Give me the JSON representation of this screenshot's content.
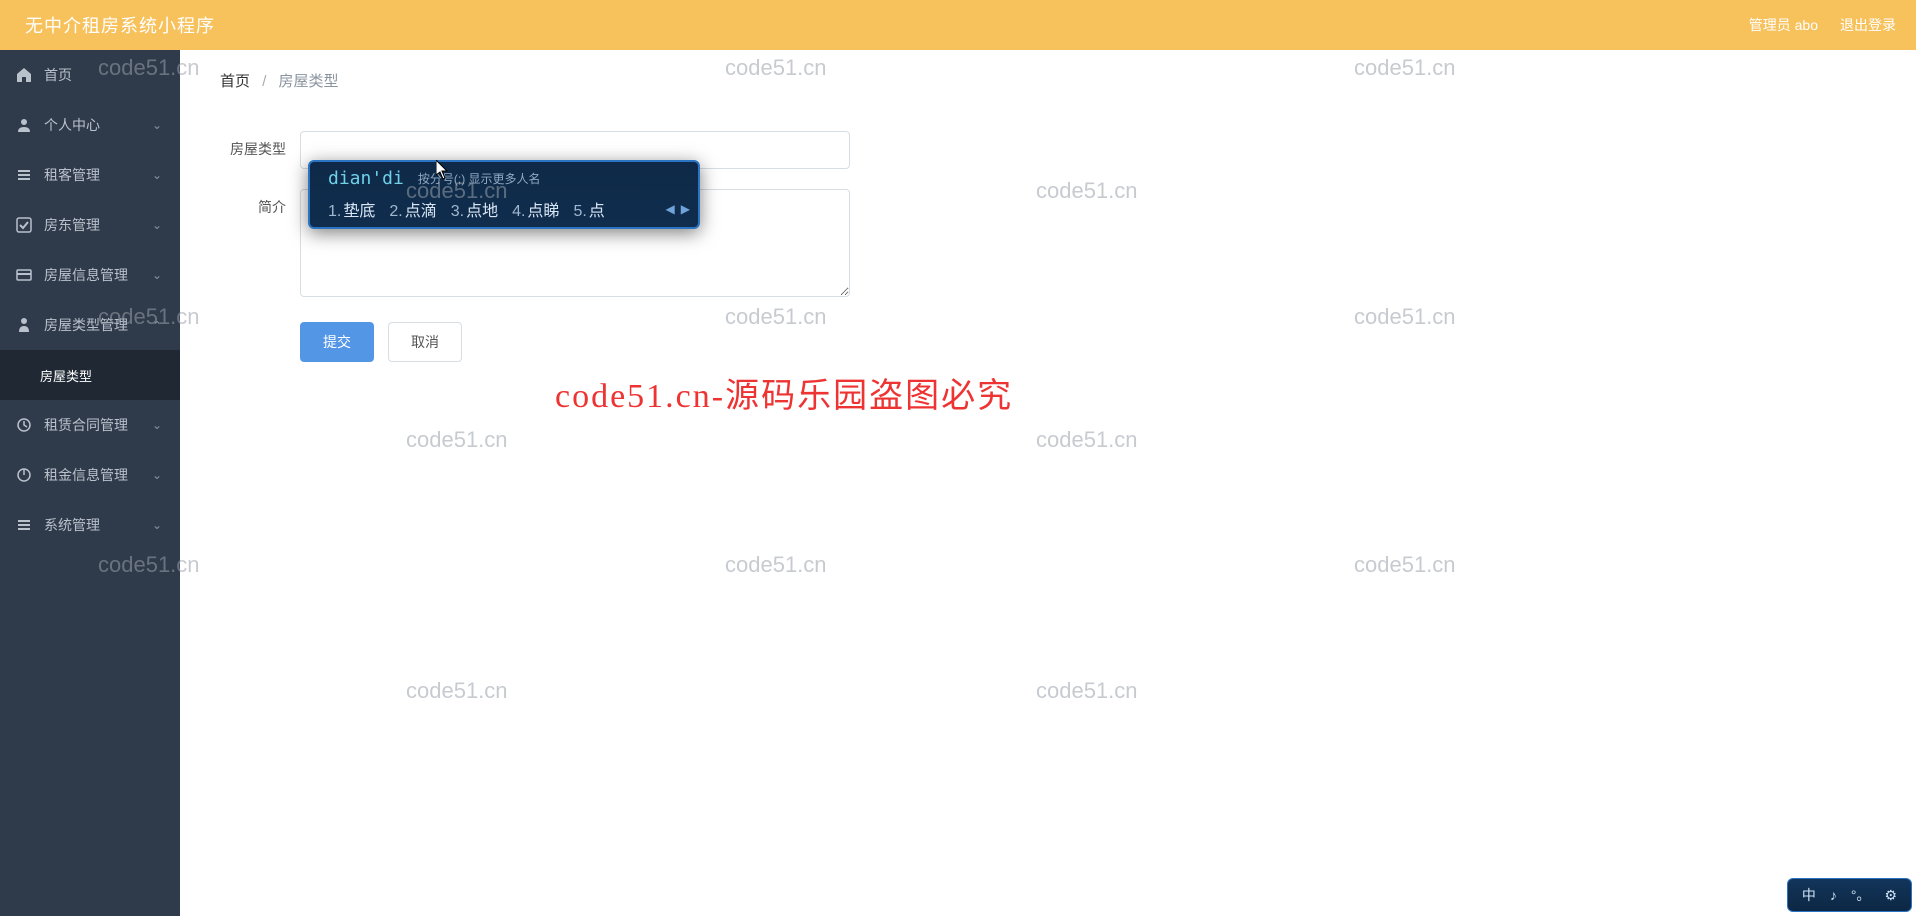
{
  "header": {
    "title": "无中介租房系统小程序",
    "user_label": "管理员 abo",
    "logout": "退出登录"
  },
  "sidebar": {
    "items": [
      {
        "icon": "home",
        "label": "首页",
        "expandable": false
      },
      {
        "icon": "user",
        "label": "个人中心",
        "expandable": true
      },
      {
        "icon": "list",
        "label": "租客管理",
        "expandable": true
      },
      {
        "icon": "check",
        "label": "房东管理",
        "expandable": true
      },
      {
        "icon": "card",
        "label": "房屋信息管理",
        "expandable": true
      },
      {
        "icon": "tag",
        "label": "房屋类型管理",
        "expandable": true,
        "expanded": true,
        "children": [
          {
            "label": "房屋类型",
            "active": true
          }
        ]
      },
      {
        "icon": "doc",
        "label": "租赁合同管理",
        "expandable": true
      },
      {
        "icon": "power",
        "label": "租金信息管理",
        "expandable": true
      },
      {
        "icon": "bars",
        "label": "系统管理",
        "expandable": true
      }
    ]
  },
  "breadcrumb": {
    "home": "首页",
    "sep": "/",
    "current": "房屋类型"
  },
  "form": {
    "type_label": "房屋类型",
    "type_value": "",
    "intro_label": "简介",
    "intro_value": "",
    "submit": "提交",
    "cancel": "取消"
  },
  "ime": {
    "input": "dian'di",
    "hint": "按分号(;) 显示更多人名",
    "candidates": [
      {
        "n": "1",
        "w": "垫底"
      },
      {
        "n": "2",
        "w": "点滴"
      },
      {
        "n": "3",
        "w": "点地"
      },
      {
        "n": "4",
        "w": "点睇"
      },
      {
        "n": "5",
        "w": "点"
      }
    ],
    "prev": "◀",
    "next": "▶"
  },
  "ime_dock": {
    "mode": "中",
    "shape": "♪",
    "punct": "°。",
    "setting": "⚙"
  },
  "watermark": {
    "text": "code51.cn",
    "red": "code51.cn-源码乐园盗图必究"
  }
}
